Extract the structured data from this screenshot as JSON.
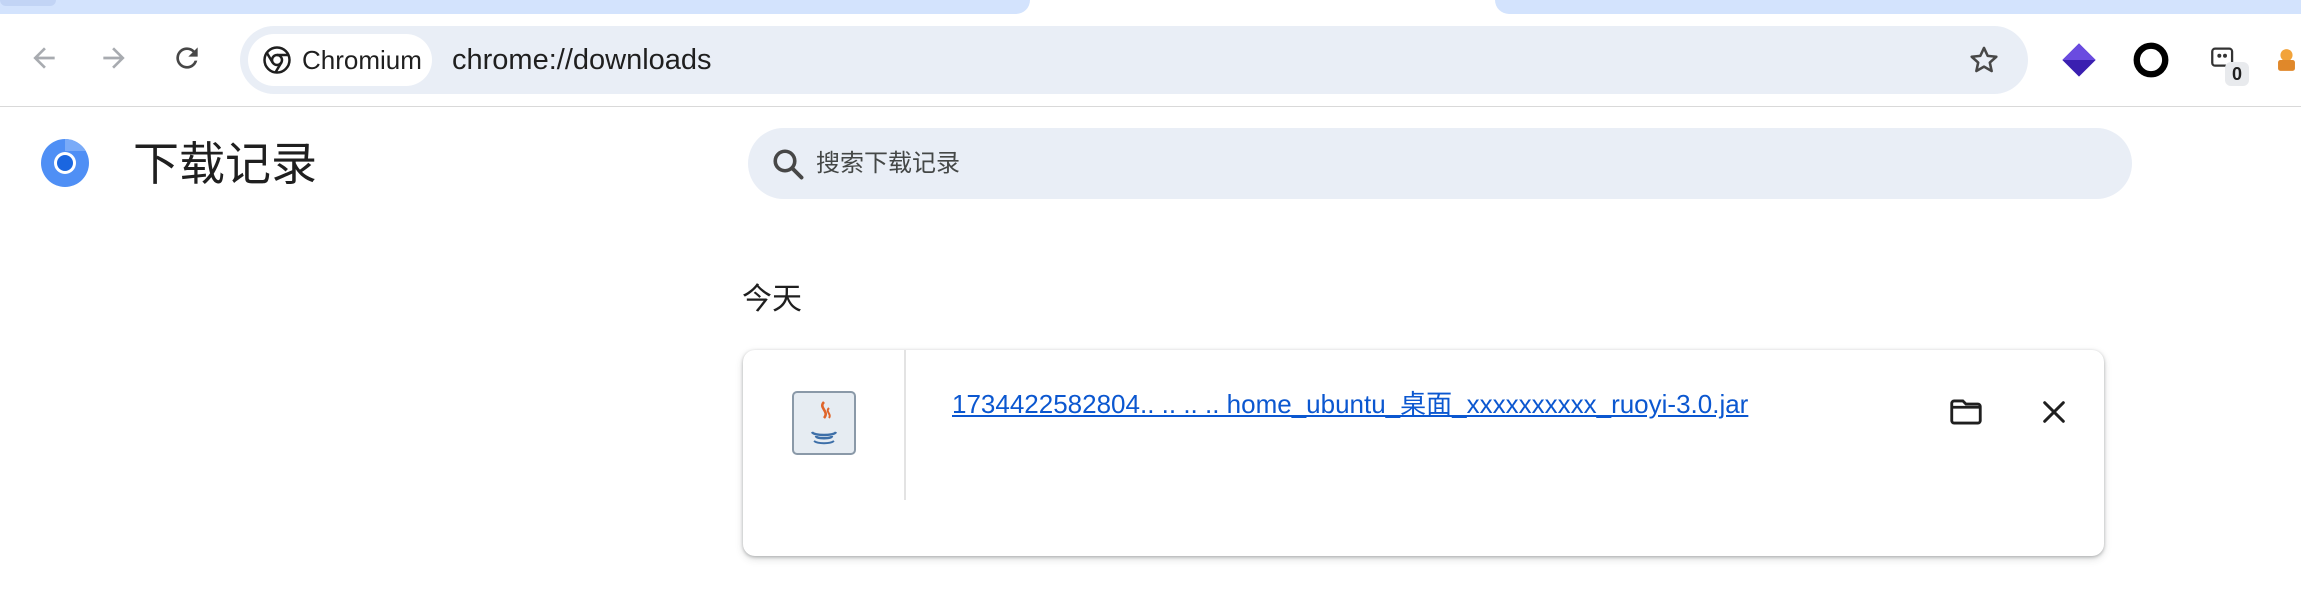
{
  "browser": {
    "site_chip_label": "Chromium",
    "url": "chrome://downloads",
    "extensions": [
      {
        "name": "layers-extension-icon"
      },
      {
        "name": "ring-extension-icon"
      },
      {
        "name": "puzzle-counter-extension-icon",
        "badge": "0"
      },
      {
        "name": "partial-extension-icon"
      }
    ]
  },
  "page": {
    "title": "下载记录",
    "search_placeholder": "搜索下载记录"
  },
  "downloads": {
    "date_header": "今天",
    "items": [
      {
        "file_name": "1734422582804.. .. .. .. home_ubuntu_桌面_xxxxxxxxxx_ruoyi-3.0.jar",
        "icon": "java-file-icon"
      }
    ]
  },
  "colors": {
    "accent": "#0b57d0",
    "omnibox_bg": "#e9eef6",
    "tab_bg": "#d3e3fd"
  }
}
